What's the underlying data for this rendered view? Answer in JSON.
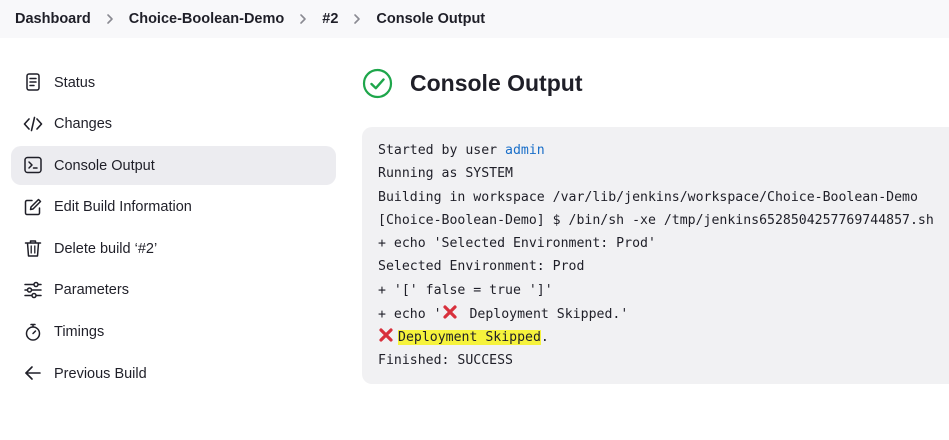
{
  "breadcrumb": {
    "items": [
      "Dashboard",
      "Choice-Boolean-Demo",
      "#2",
      "Console Output"
    ]
  },
  "sidebar": {
    "items": [
      {
        "label": "Status",
        "icon": "document-icon"
      },
      {
        "label": "Changes",
        "icon": "code-icon"
      },
      {
        "label": "Console Output",
        "icon": "terminal-icon",
        "active": true
      },
      {
        "label": "Edit Build Information",
        "icon": "edit-icon"
      },
      {
        "label": "Delete build ‘#2’",
        "icon": "trash-icon"
      },
      {
        "label": "Parameters",
        "icon": "sliders-icon"
      },
      {
        "label": "Timings",
        "icon": "stopwatch-icon"
      },
      {
        "label": "Previous Build",
        "icon": "arrow-left-icon"
      }
    ]
  },
  "main": {
    "title": "Console Output",
    "status_icon": "success-check-icon",
    "status_color": "#1ea64b"
  },
  "console": {
    "started_prefix": "Started by user ",
    "started_user": "admin",
    "lines": [
      "Running as SYSTEM",
      "Building in workspace /var/lib/jenkins/workspace/Choice-Boolean-Demo",
      "[Choice-Boolean-Demo] $ /bin/sh -xe /tmp/jenkins6528504257769744857.sh",
      "+ echo 'Selected Environment: Prod'",
      "Selected Environment: Prod",
      "+ '[' false = true ']'"
    ],
    "echo_prefix": "+ echo '",
    "echo_suffix": " Deployment Skipped.'",
    "skip_highlighted": "Deployment Skipped",
    "skip_tail": ".",
    "finished": "Finished: SUCCESS",
    "cross_color": "#d8303c",
    "highlight_color": "#f6f33c"
  }
}
